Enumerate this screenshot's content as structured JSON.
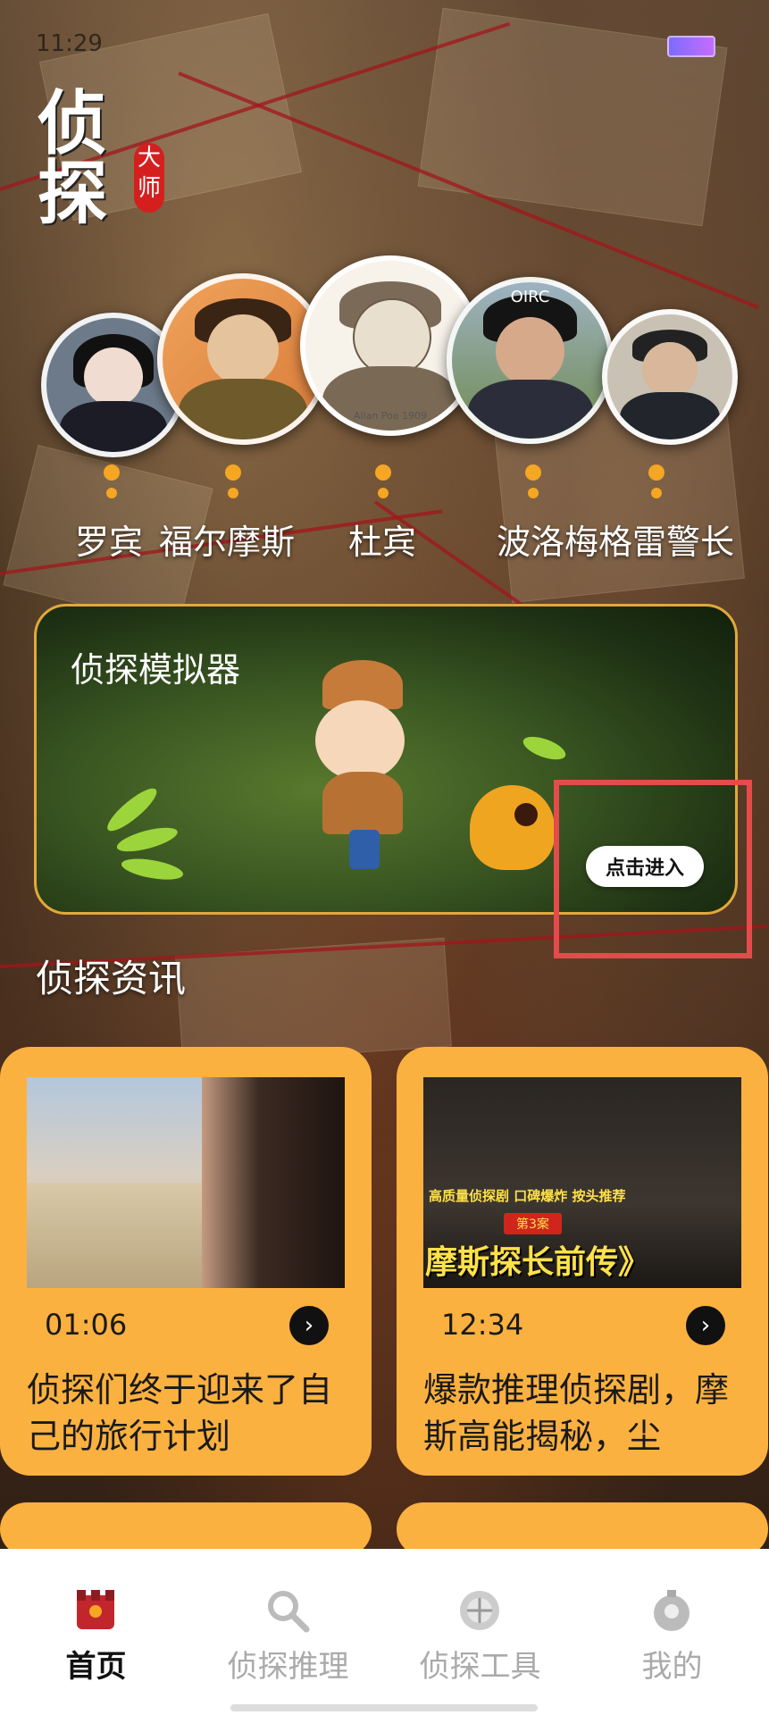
{
  "status_bar": {
    "time": "11:29"
  },
  "logo": {
    "main": "侦探",
    "seal": "大师"
  },
  "detectives": [
    {
      "name": "罗宾",
      "avatar_caption": ""
    },
    {
      "name": "福尔摩斯",
      "avatar_caption": ""
    },
    {
      "name": "杜宾",
      "avatar_caption": "Allan Poe 1909"
    },
    {
      "name": "波洛",
      "avatar_caption": "OIRC"
    },
    {
      "name": "梅格雷警长",
      "avatar_caption": ""
    }
  ],
  "simulator": {
    "title": "侦探模拟器",
    "enter_label": "点击进入"
  },
  "news": {
    "section_title": "侦探资讯",
    "items": [
      {
        "duration": "01:06",
        "title": "侦探们终于迎来了自己的旅行计划"
      },
      {
        "duration": "12:34",
        "title": "爆款推理侦探剧，摩斯高能揭秘，尘",
        "thumb_caption_top": "高质量侦探剧 口碑爆炸 按头推荐",
        "thumb_caption_case": "第3案",
        "thumb_caption_main": "摩斯探长前传》"
      }
    ]
  },
  "tabs": [
    {
      "label": "首页",
      "icon": "home-icon",
      "active": true
    },
    {
      "label": "侦探推理",
      "icon": "magnifier-icon",
      "active": false
    },
    {
      "label": "侦探工具",
      "icon": "tool-icon",
      "active": false
    },
    {
      "label": "我的",
      "icon": "profile-icon",
      "active": false
    }
  ],
  "colors": {
    "accent": "#fbb140",
    "highlight": "#e54b4b",
    "seal": "#d51f1f"
  }
}
